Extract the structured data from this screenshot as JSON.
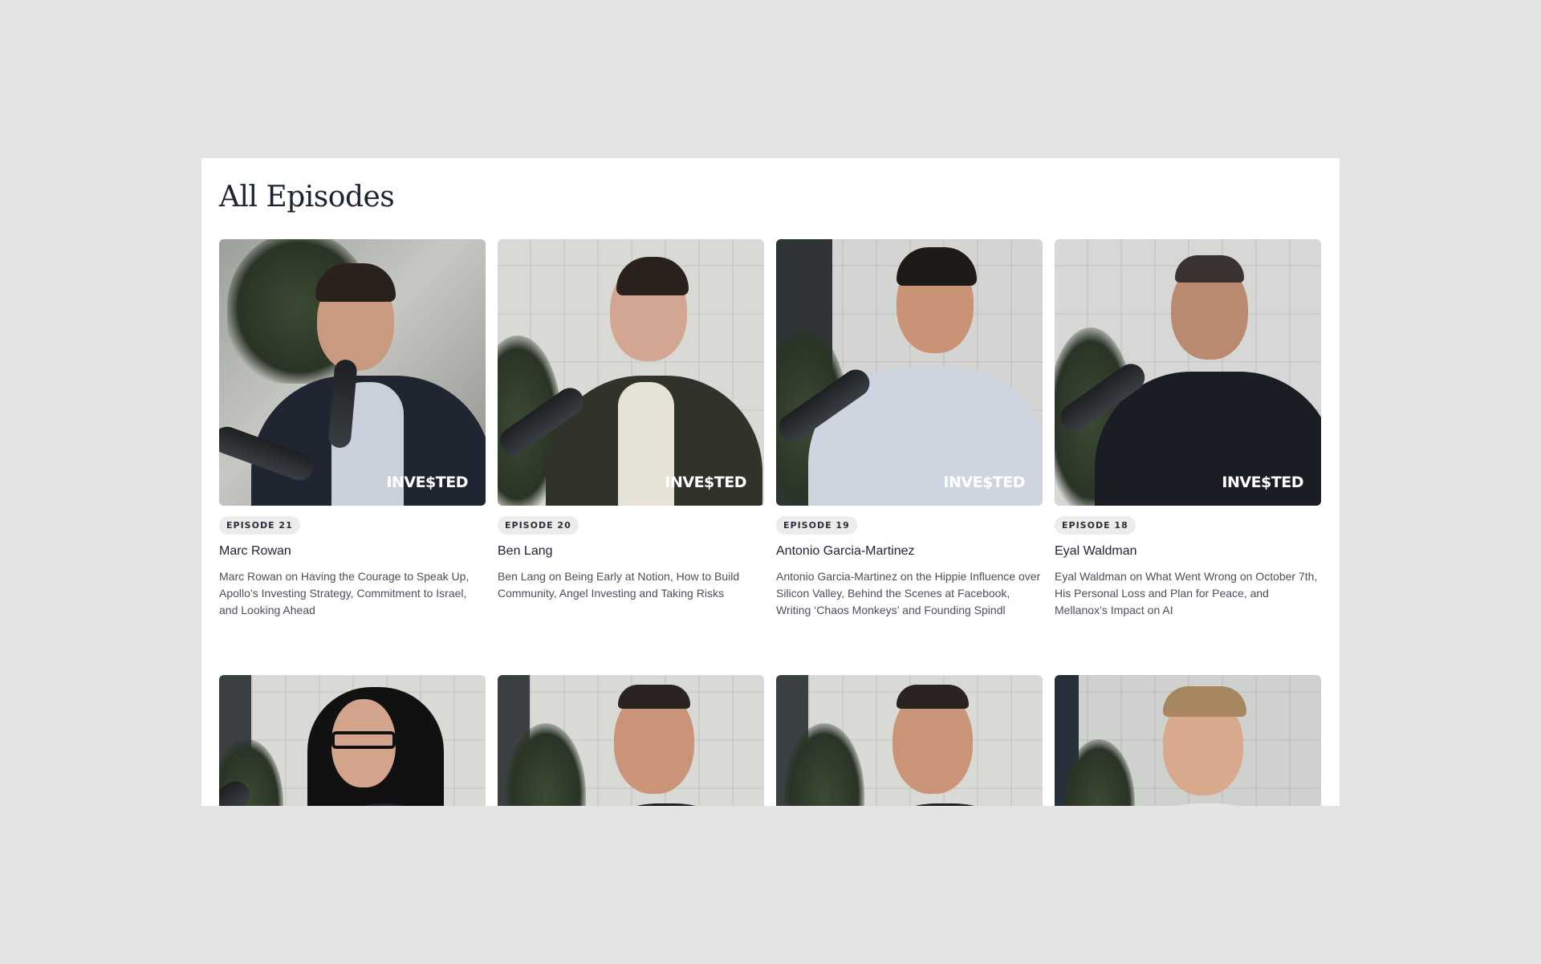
{
  "section": {
    "title": "All Episodes"
  },
  "brand": {
    "logo_text": "INVE$TED"
  },
  "episodes": [
    {
      "badge": "EPISODE 21",
      "guest": "Marc Rowan",
      "description": "Marc Rowan on Having the Courage to Speak Up, Apollo’s Investing Strategy, Commitment to Israel, and Looking Ahead"
    },
    {
      "badge": "EPISODE 20",
      "guest": "Ben Lang",
      "description": "Ben Lang on Being Early at Notion, How to Build Community, Angel Investing and Taking Risks"
    },
    {
      "badge": "EPISODE 19",
      "guest": "Antonio Garcia-Martinez",
      "description": "Antonio Garcia-Martinez on the Hippie Influence over Silicon Valley, Behind the Scenes at Facebook, Writing ‘Chaos Monkeys’ and Founding Spindl"
    },
    {
      "badge": "EPISODE 18",
      "guest": "Eyal Waldman",
      "description": "Eyal Waldman on What Went Wrong on October 7th, His Personal Loss and Plan for Peace, and Mellanox’s Impact on AI"
    }
  ],
  "thumbnail_colors": {
    "wall_light": "#d9d9d6",
    "wall_dark": "#2f3437",
    "suit_navy": "#1f2531",
    "jacket_olive": "#2f3329",
    "shirt_light_blue": "#c9d0dc",
    "tee_black": "#1b1d24",
    "blouse_navy": "#1e2433",
    "shirt_white": "#e6e4df",
    "hair_dark": "#2b211c",
    "hair_black": "#111111",
    "hair_blond": "#a7875f"
  }
}
